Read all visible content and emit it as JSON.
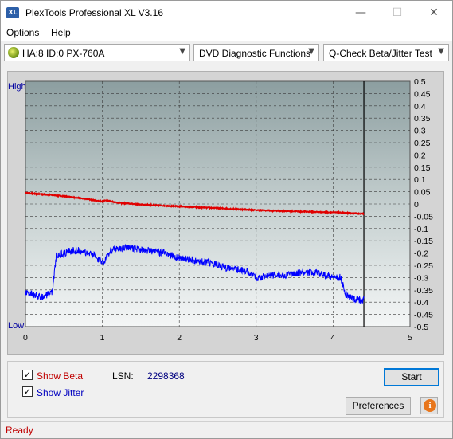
{
  "window": {
    "title": "PlexTools Professional XL V3.16",
    "icon_text": "XL"
  },
  "menu": {
    "options": "Options",
    "help": "Help"
  },
  "toolbar": {
    "drive": "HA:8 ID:0  PX-760A",
    "function": "DVD Diagnostic Functions",
    "test": "Q-Check Beta/Jitter Test"
  },
  "chart_data": {
    "type": "line",
    "x_ticks": [
      "0",
      "1",
      "2",
      "3",
      "4",
      "5"
    ],
    "xlim": [
      0,
      5
    ],
    "y_left_labels": {
      "high": "High",
      "low": "Low"
    },
    "y_right_ticks": [
      "0.5",
      "0.45",
      "0.4",
      "0.35",
      "0.3",
      "0.25",
      "0.2",
      "0.15",
      "0.1",
      "0.05",
      "0",
      "-0.05",
      "-0.1",
      "-0.15",
      "-0.2",
      "-0.25",
      "-0.3",
      "-0.35",
      "-0.4",
      "-0.45",
      "-0.5"
    ],
    "ylim": [
      -0.5,
      0.5
    ],
    "end_marker_x": 4.4,
    "grid": true,
    "series": [
      {
        "color": "#e00000",
        "x": [
          0,
          0.2,
          0.4,
          0.6,
          0.8,
          1.0,
          1.05,
          1.2,
          1.5,
          2.0,
          2.5,
          3.0,
          3.5,
          4.0,
          4.2,
          4.4
        ],
        "values": [
          0.045,
          0.04,
          0.035,
          0.028,
          0.02,
          0.01,
          0.015,
          0.005,
          -0.002,
          -0.01,
          -0.017,
          -0.025,
          -0.03,
          -0.034,
          -0.037,
          -0.04
        ]
      },
      {
        "color": "#0000ff",
        "x": [
          0,
          0.1,
          0.2,
          0.3,
          0.35,
          0.4,
          0.5,
          0.6,
          0.7,
          0.8,
          0.9,
          1.0,
          1.05,
          1.1,
          1.2,
          1.4,
          1.6,
          1.8,
          2.0,
          2.2,
          2.4,
          2.6,
          2.8,
          2.9,
          3.0,
          3.2,
          3.4,
          3.6,
          3.8,
          4.0,
          4.1,
          4.15,
          4.2,
          4.3,
          4.4
        ],
        "values": [
          -0.36,
          -0.37,
          -0.38,
          -0.37,
          -0.36,
          -0.21,
          -0.2,
          -0.19,
          -0.19,
          -0.2,
          -0.21,
          -0.24,
          -0.22,
          -0.19,
          -0.18,
          -0.18,
          -0.19,
          -0.2,
          -0.22,
          -0.23,
          -0.24,
          -0.26,
          -0.27,
          -0.28,
          -0.3,
          -0.29,
          -0.29,
          -0.28,
          -0.28,
          -0.3,
          -0.3,
          -0.36,
          -0.38,
          -0.39,
          -0.39
        ]
      }
    ]
  },
  "options_panel": {
    "show_beta_label": "Show Beta",
    "show_beta_checked": true,
    "show_jitter_label": "Show Jitter",
    "show_jitter_checked": true,
    "beta_color": "#c00000",
    "jitter_color": "#0000c0",
    "lsn_label": "LSN:",
    "lsn_value": "2298368"
  },
  "buttons": {
    "start": "Start",
    "preferences": "Preferences",
    "info_icon": "info-icon"
  },
  "status": {
    "text": "Ready",
    "color": "#c00000"
  }
}
